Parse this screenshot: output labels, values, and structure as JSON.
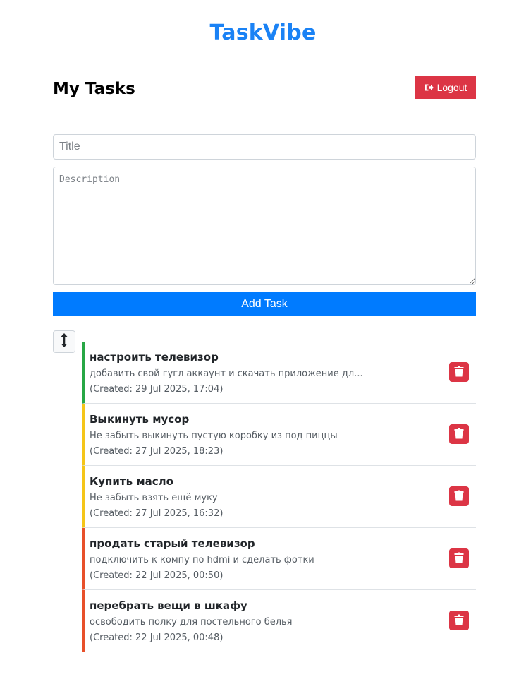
{
  "app": {
    "title": "TaskVibe"
  },
  "header": {
    "page_title": "My Tasks",
    "logout_label": "Logout",
    "logout_icon": "sign-out-icon"
  },
  "form": {
    "title_placeholder": "Title",
    "description_placeholder": "Description",
    "add_button_label": "Add Task"
  },
  "sort": {
    "icon": "sort-vertical-arrows-icon"
  },
  "colors": {
    "brand": "#1a82f5",
    "primary": "#007bff",
    "danger": "#dc3545",
    "priority_low": "#28a745",
    "priority_medium": "#f5c518",
    "priority_high": "#e8502a"
  },
  "tasks": [
    {
      "title": "настроить телевизор",
      "description": "добавить свой гугл аккаунт и скачать приложение дл...",
      "created": "(Created: 29 Jul 2025, 17:04)",
      "priority_color": "#28a745",
      "delete_icon": "trash-icon"
    },
    {
      "title": "Выкинуть мусор",
      "description": "Не забыть выкинуть пустую коробку из под пиццы",
      "created": "(Created: 27 Jul 2025, 18:23)",
      "priority_color": "#f5c518",
      "delete_icon": "trash-icon"
    },
    {
      "title": "Купить масло",
      "description": "Не забыть взять ещё муку",
      "created": "(Created: 27 Jul 2025, 16:32)",
      "priority_color": "#f5c518",
      "delete_icon": "trash-icon"
    },
    {
      "title": "продать старый телевизор",
      "description": "подключить к компу по hdmi и сделать фотки",
      "created": "(Created: 22 Jul 2025, 00:50)",
      "priority_color": "#e8502a",
      "delete_icon": "trash-icon"
    },
    {
      "title": "перебрать вещи в шкафу",
      "description": "освободить полку для постельного белья",
      "created": "(Created: 22 Jul 2025, 00:48)",
      "priority_color": "#e8502a",
      "delete_icon": "trash-icon"
    }
  ]
}
